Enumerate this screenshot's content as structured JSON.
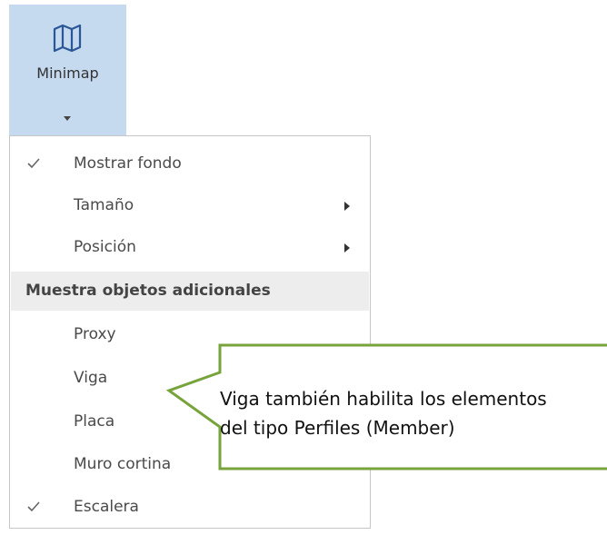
{
  "ribbon": {
    "button_label": "Minimap",
    "icon": "map-icon",
    "dropdown_icon": "caret-down-icon"
  },
  "menu": {
    "top_items": [
      {
        "label": "Mostrar fondo",
        "checked": true,
        "submenu": false
      },
      {
        "label": "Tamaño",
        "checked": false,
        "submenu": true
      },
      {
        "label": "Posición",
        "checked": false,
        "submenu": true
      }
    ],
    "section_header": "Muestra objetos adicionales",
    "section_items": [
      {
        "label": "Proxy",
        "checked": false
      },
      {
        "label": "Viga",
        "checked": false
      },
      {
        "label": "Placa",
        "checked": false
      },
      {
        "label": "Muro cortina",
        "checked": false
      },
      {
        "label": "Escalera",
        "checked": true
      }
    ]
  },
  "callout": {
    "line1": "Viga también habilita los elementos",
    "line2": "del tipo Perfiles (Member)",
    "border_color": "#77a33b"
  },
  "colors": {
    "ribbon_selected_bg": "#c5d9ef",
    "menu_border": "#c6c6c6",
    "section_bg": "#ededed"
  }
}
